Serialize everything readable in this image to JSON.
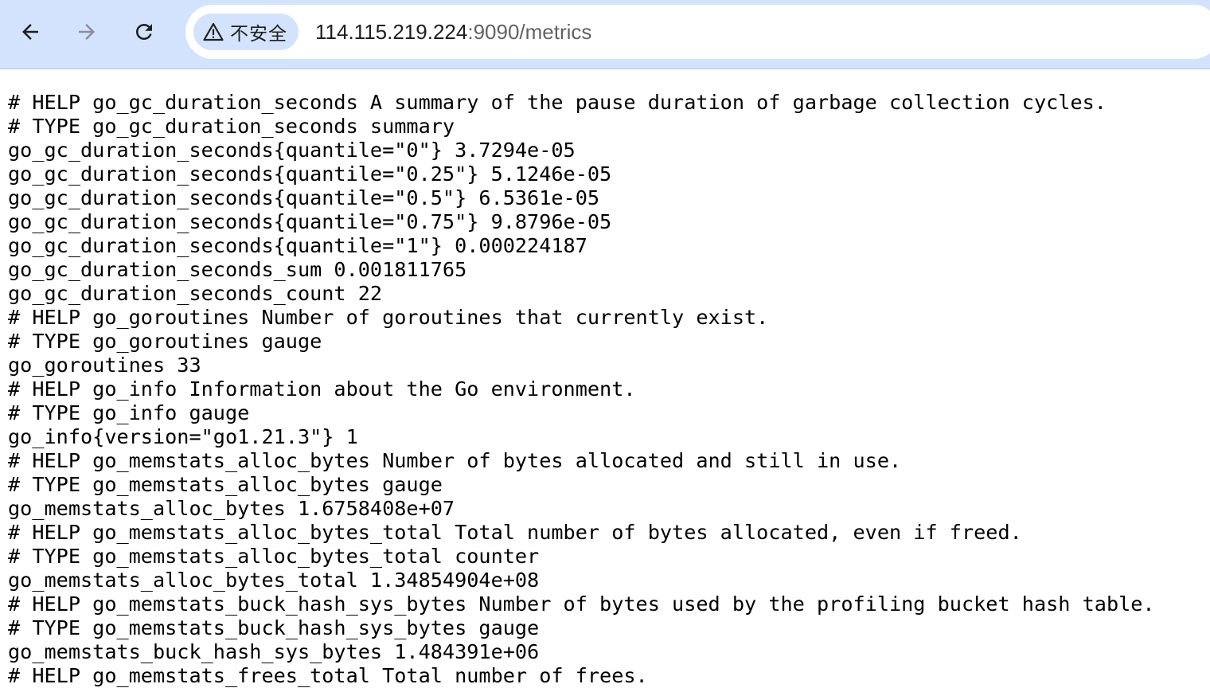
{
  "browser": {
    "nav": {
      "back_icon": "arrow-left-icon",
      "forward_icon": "arrow-right-icon",
      "reload_icon": "reload-icon"
    },
    "security_chip": {
      "icon": "warning-triangle-icon",
      "label": "不安全"
    },
    "url": {
      "host": "114.115.219.224",
      "rest": ":9090/metrics"
    },
    "colors": {
      "toolbar": "#d3e3fd",
      "omnibox": "#ffffff",
      "host_text": "#1f1f1f",
      "path_text": "#5f6368"
    }
  },
  "metrics_text": {
    "lines": [
      "# HELP go_gc_duration_seconds A summary of the pause duration of garbage collection cycles.",
      "# TYPE go_gc_duration_seconds summary",
      "go_gc_duration_seconds{quantile=\"0\"} 3.7294e-05",
      "go_gc_duration_seconds{quantile=\"0.25\"} 5.1246e-05",
      "go_gc_duration_seconds{quantile=\"0.5\"} 6.5361e-05",
      "go_gc_duration_seconds{quantile=\"0.75\"} 9.8796e-05",
      "go_gc_duration_seconds{quantile=\"1\"} 0.000224187",
      "go_gc_duration_seconds_sum 0.001811765",
      "go_gc_duration_seconds_count 22",
      "# HELP go_goroutines Number of goroutines that currently exist.",
      "# TYPE go_goroutines gauge",
      "go_goroutines 33",
      "# HELP go_info Information about the Go environment.",
      "# TYPE go_info gauge",
      "go_info{version=\"go1.21.3\"} 1",
      "# HELP go_memstats_alloc_bytes Number of bytes allocated and still in use.",
      "# TYPE go_memstats_alloc_bytes gauge",
      "go_memstats_alloc_bytes 1.6758408e+07",
      "# HELP go_memstats_alloc_bytes_total Total number of bytes allocated, even if freed.",
      "# TYPE go_memstats_alloc_bytes_total counter",
      "go_memstats_alloc_bytes_total 1.34854904e+08",
      "# HELP go_memstats_buck_hash_sys_bytes Number of bytes used by the profiling bucket hash table.",
      "# TYPE go_memstats_buck_hash_sys_bytes gauge",
      "go_memstats_buck_hash_sys_bytes 1.484391e+06",
      "# HELP go_memstats_frees_total Total number of frees."
    ]
  }
}
